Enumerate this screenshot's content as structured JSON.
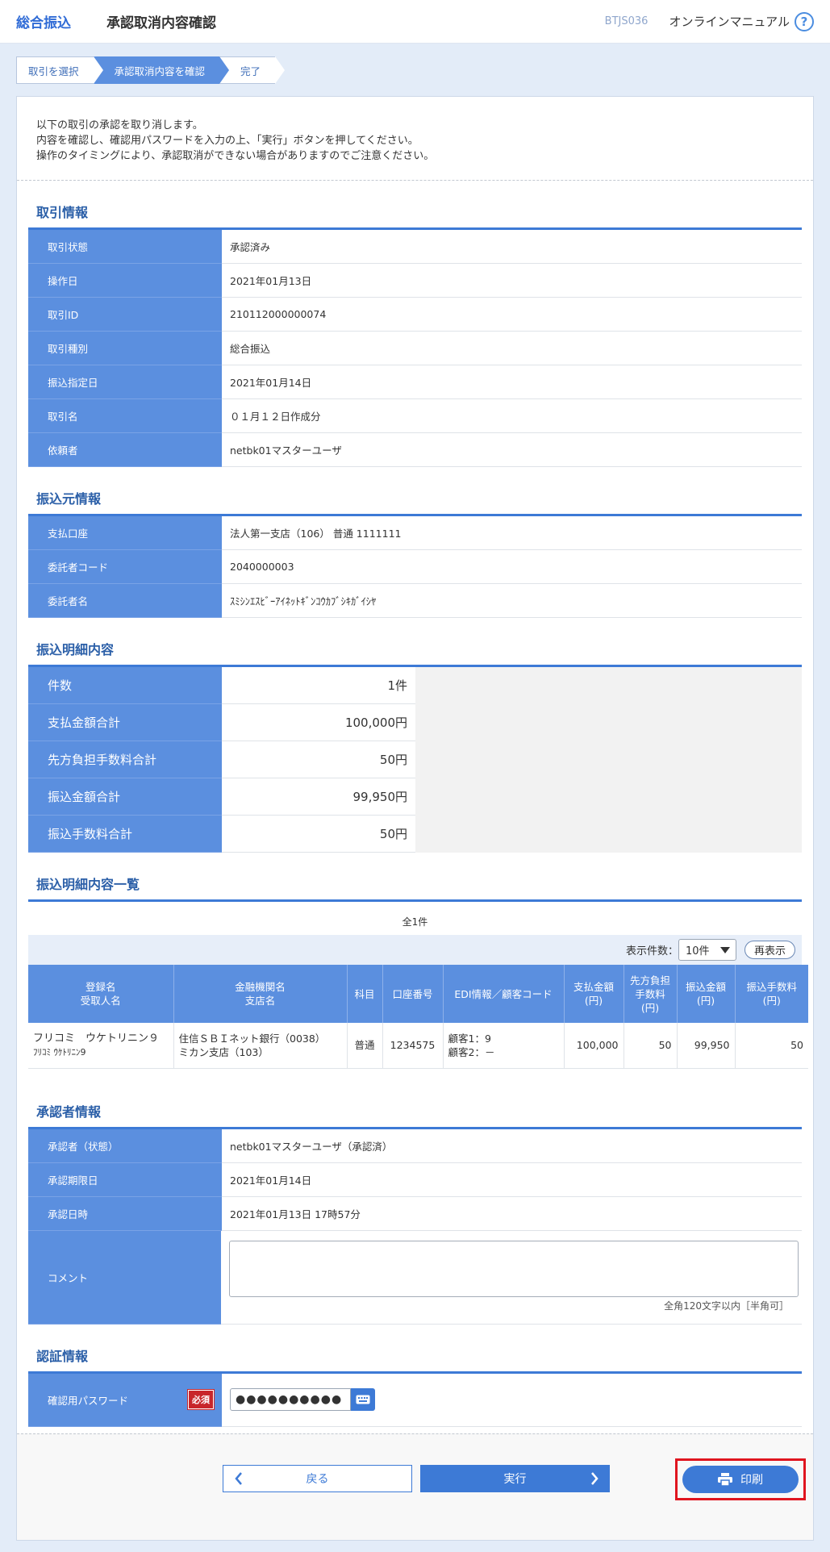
{
  "header": {
    "service": "総合振込",
    "title": "承認取消内容確認",
    "screen_id": "BTJS036",
    "manual": "オンラインマニュアル",
    "help": "?"
  },
  "steps": [
    "取引を選択",
    "承認取消内容を確認",
    "完了"
  ],
  "intro": [
    "以下の取引の承認を取り消します。",
    "内容を確認し、確認用パスワードを入力の上、「実行」ボタンを押してください。",
    "操作のタイミングにより、承認取消ができない場合がありますのでご注意ください。"
  ],
  "transaction": {
    "title": "取引情報",
    "rows": [
      {
        "label": "取引状態",
        "value": "承認済み"
      },
      {
        "label": "操作日",
        "value": "2021年01月13日"
      },
      {
        "label": "取引ID",
        "value": "210112000000074"
      },
      {
        "label": "取引種別",
        "value": "総合振込"
      },
      {
        "label": "振込指定日",
        "value": "2021年01月14日"
      },
      {
        "label": "取引名",
        "value": "０１月１２日作成分"
      },
      {
        "label": "依頼者",
        "value": "netbk01マスターユーザ"
      }
    ]
  },
  "source": {
    "title": "振込元情報",
    "rows": [
      {
        "label": "支払口座",
        "value": "法人第一支店（106） 普通 1111111"
      },
      {
        "label": "委託者コード",
        "value": "2040000003"
      },
      {
        "label": "委託者名",
        "value": "ｽﾐｼﾝｴｽﾋﾞｰｱｲﾈｯﾄｷﾞﾝｺｳｶﾌﾞｼｷｶﾞｲｼﾔ"
      }
    ]
  },
  "summary": {
    "title": "振込明細内容",
    "rows": [
      {
        "label": "件数",
        "value": "1件"
      },
      {
        "label": "支払金額合計",
        "value": "100,000円"
      },
      {
        "label": "先方負担手数料合計",
        "value": "50円"
      },
      {
        "label": "振込金額合計",
        "value": "99,950円"
      },
      {
        "label": "振込手数料合計",
        "value": "50円"
      }
    ]
  },
  "detail": {
    "title": "振込明細内容一覧",
    "total": "全1件",
    "per_page_label": "表示件数：",
    "per_page_value": "10件",
    "redisplay": "再表示",
    "headers": [
      "登録名\n受取人名",
      "金融機関名\n支店名",
      "科目",
      "口座番号",
      "EDI情報／顧客コード",
      "支払金額\n(円)",
      "先方負担\n手数料\n(円)",
      "振込金額\n(円)",
      "振込手数料\n(円)"
    ],
    "row": {
      "name": "フリコミ　ウケトリニン９",
      "name_kana": "ﾌﾘｺﾐ ｳｹﾄﾘﾆﾝ9",
      "bank": "住信ＳＢＩネット銀行（0038）\nミカン支店（103）",
      "type": "普通",
      "account": "1234575",
      "edi": "顧客1：9\n顧客2：－",
      "pay": "100,000",
      "fee_borne": "50",
      "transfer": "99,950",
      "transfer_fee": "50"
    }
  },
  "approver": {
    "title": "承認者情報",
    "rows": [
      {
        "label": "承認者（状態）",
        "value": "netbk01マスターユーザ（承認済）"
      },
      {
        "label": "承認期限日",
        "value": "2021年01月14日"
      },
      {
        "label": "承認日時",
        "value": "2021年01月13日 17時57分"
      }
    ],
    "comment_label": "コメント",
    "comment_value": "",
    "comment_note": "全角120文字以内［半角可］"
  },
  "auth": {
    "title": "認証情報",
    "password_label": "確認用パスワード",
    "required": "必須",
    "password_value": "●●●●●●●●●●"
  },
  "buttons": {
    "back": "戻る",
    "execute": "実行",
    "print": "印刷"
  }
}
